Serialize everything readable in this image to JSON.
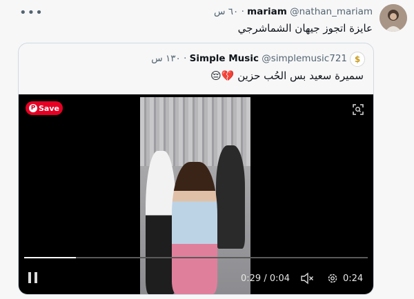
{
  "tweet": {
    "author_name": "mariam",
    "author_handle": "@nathan_mariam",
    "time": "٦٠ س",
    "text": "عايزة اتجوز جيهان الشماشرجي",
    "more_label": "•••"
  },
  "quote": {
    "author_name": "Simple Music",
    "author_handle": "@simplemusic721",
    "time": "١٣٠ س",
    "text": "سميرة سعيد بس الحُب حزين 💔😔"
  },
  "video": {
    "save_label": "Save",
    "elapsed": "0:29",
    "duration": "0:04",
    "remaining": "0:24",
    "progress": 0.15
  },
  "colors": {
    "pinterest_red": "#e60023",
    "border": "#cfd9de",
    "muted": "#536471"
  }
}
